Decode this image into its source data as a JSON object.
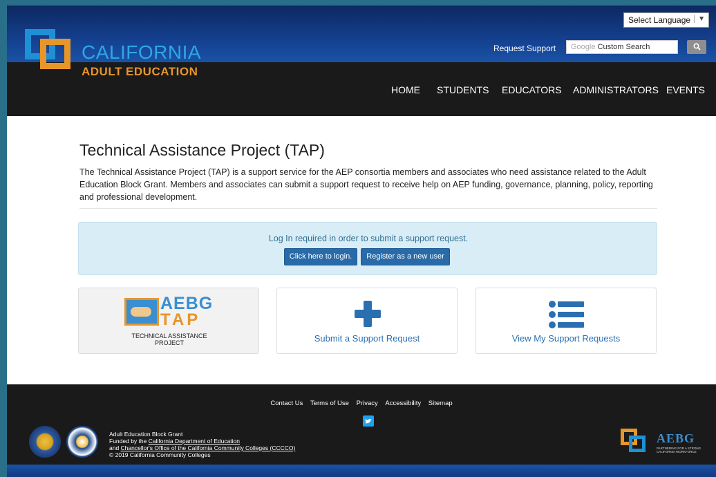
{
  "header": {
    "logo_title": "CALIFORNIA",
    "logo_subtitle": "ADULT EDUCATION",
    "language_select": "Select Language",
    "request_support": "Request Support",
    "search_brand": "Google",
    "search_placeholder": "Custom Search",
    "nav": [
      "HOME",
      "STUDENTS",
      "EDUCATORS",
      "ADMINISTRATORS",
      "EVENTS"
    ]
  },
  "main": {
    "title": "Technical Assistance Project (TAP)",
    "intro": "The Technical Assistance Project (TAP) is a support service for the AEP consortia members and associates who need assistance related to the Adult Education Block Grant. Members and associates can submit a support request to receive help on AEP funding, governance, planning, policy, reporting and professional development.",
    "alert": {
      "text": "Log In required in order to submit a support request.",
      "login_button": "Click here to login.",
      "register_button": "Register as a new user"
    },
    "cards": {
      "logo_line1": "AEBG",
      "logo_line2": "TAP",
      "logo_caption": "TECHNICAL ASSISTANCE PROJECT",
      "submit_label": "Submit a Support Request",
      "view_label": "View My Support Requests"
    }
  },
  "footer": {
    "links": [
      "Contact Us",
      "Terms of Use",
      "Privacy",
      "Accessibility",
      "Sitemap"
    ],
    "line1": "Adult Education Block Grant",
    "line2_prefix": "Funded by the ",
    "line2_link": "California Department of Education",
    "line3_prefix": "and ",
    "line3_link": "Chancellor's Office of the California Community Colleges (CCCCO)",
    "line4": "© 2019 California Community Colleges",
    "logo_word": "AEBG",
    "logo_tagline": "PARTNERING FOR A STRONG CALIFORNIA WORKFORCE"
  },
  "colors": {
    "brand_blue": "#1e90d6",
    "brand_orange": "#e8952a",
    "button_blue": "#286ba8",
    "alert_bg": "#d9edf7"
  }
}
